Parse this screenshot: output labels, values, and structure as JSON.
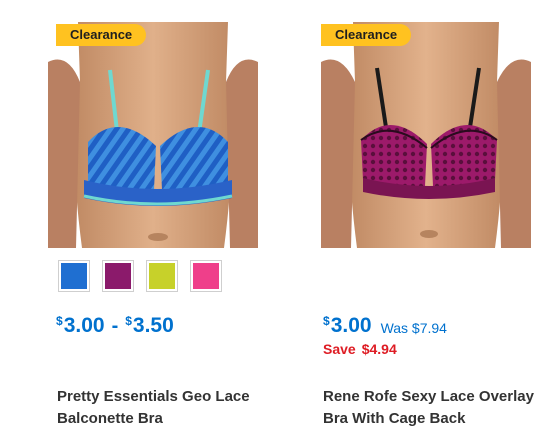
{
  "products": [
    {
      "badge": "Clearance",
      "swatches": [
        {
          "name": "blue",
          "color": "#1f6fd1"
        },
        {
          "name": "purple",
          "color": "#8b1a6b"
        },
        {
          "name": "lime",
          "color": "#c7d12a"
        },
        {
          "name": "pink",
          "color": "#ef3f8a"
        }
      ],
      "price_currency": "$",
      "price_min": "3.00",
      "price_separator": "-",
      "price_max": "3.50",
      "title_line1": "Pretty Essentials Geo Lace",
      "title_line2": "Balconette Bra"
    },
    {
      "badge": "Clearance",
      "price_currency": "$",
      "price": "3.00",
      "was_text": "Was $7.94",
      "save_label": "Save",
      "save_amount": "$4.94",
      "title_line1": "Rene Rofe Sexy Lace Overlay",
      "title_line2": "Bra With Cage Back"
    }
  ],
  "colors": {
    "badge_bg": "#ffc220",
    "price_blue": "#0071ce",
    "save_red": "#de1c24"
  }
}
